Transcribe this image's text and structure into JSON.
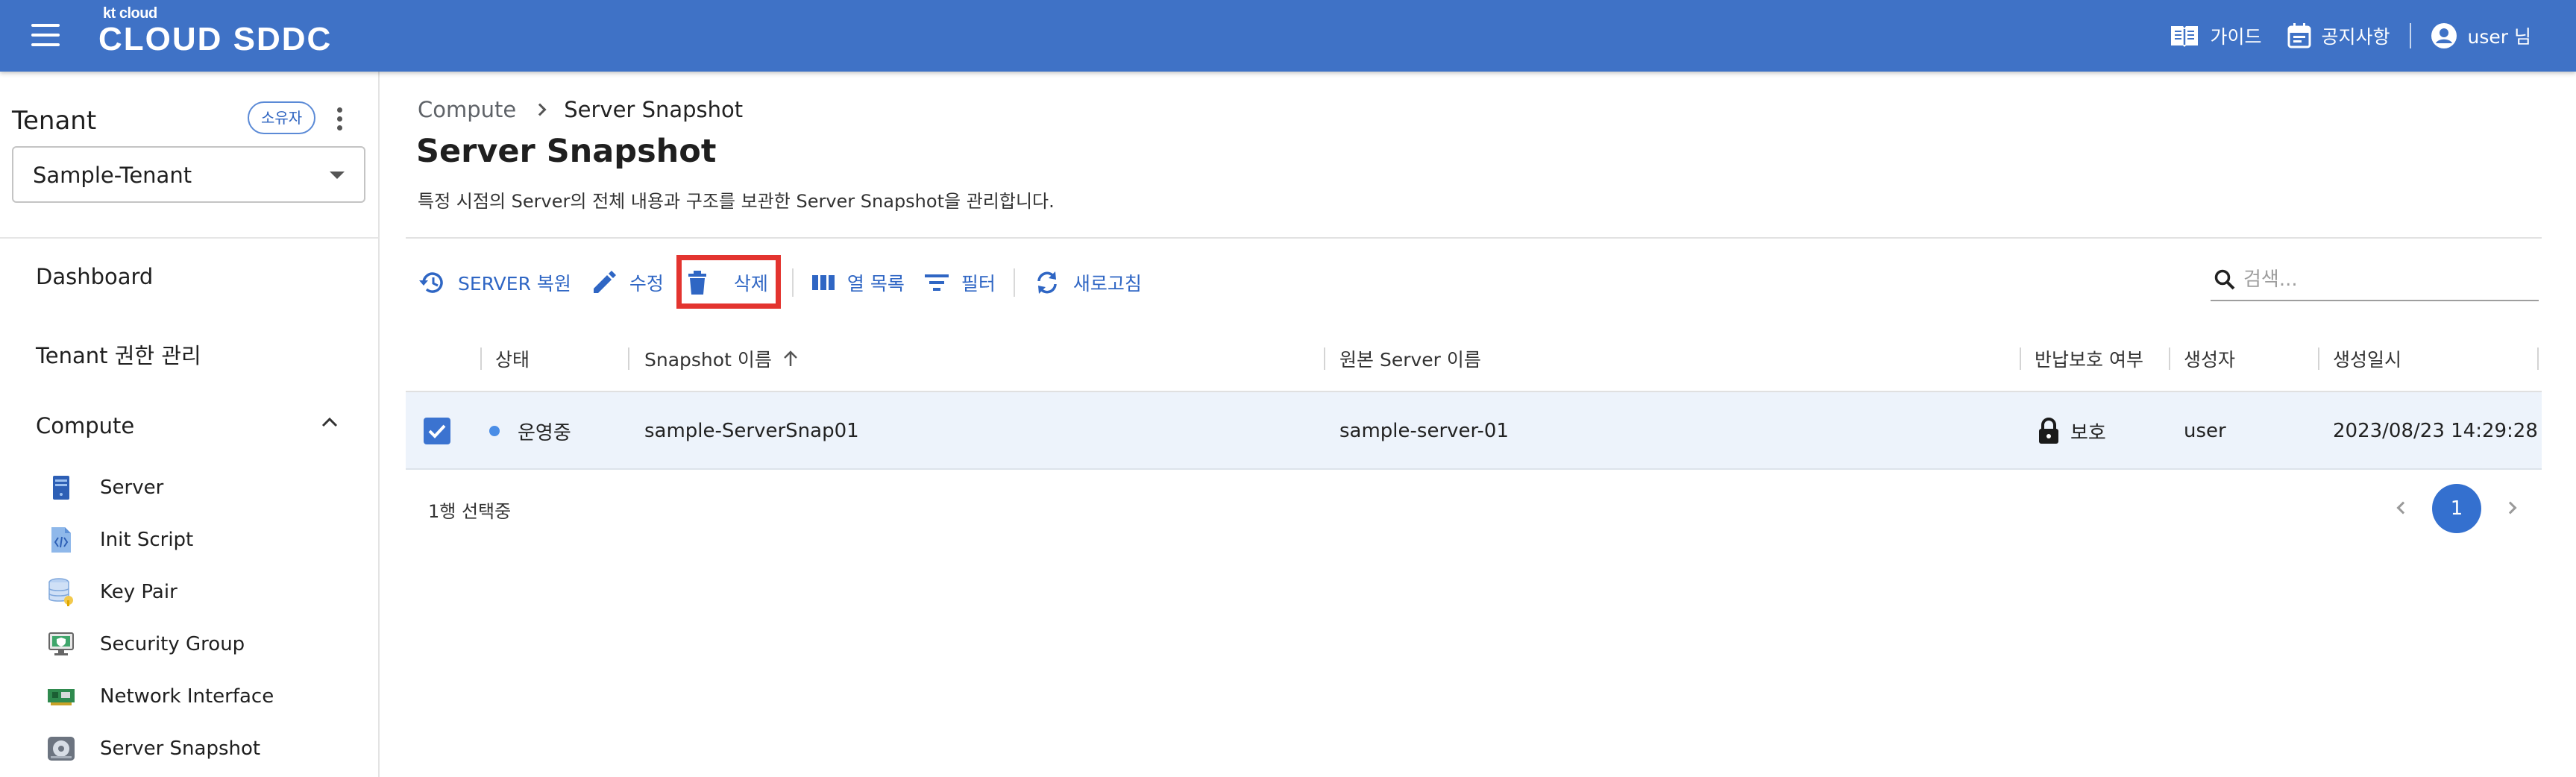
{
  "header": {
    "logo_small": "kt cloud",
    "logo_main": "CLOUD SDDC",
    "guide_label": "가이드",
    "notice_label": "공지사항",
    "user_label": "user 님",
    "bg_color": "#3f72c6"
  },
  "sidebar": {
    "tenant_title": "Tenant",
    "owner_badge": "소유자",
    "tenant_selected": "Sample-Tenant",
    "nav": {
      "dashboard": "Dashboard",
      "tenant_permission": "Tenant 권한 관리",
      "compute": "Compute"
    },
    "compute_items": [
      {
        "label": "Server",
        "icon": "server-icon"
      },
      {
        "label": "Init Script",
        "icon": "script-icon"
      },
      {
        "label": "Key Pair",
        "icon": "key-pair-icon"
      },
      {
        "label": "Security Group",
        "icon": "security-group-icon"
      },
      {
        "label": "Network Interface",
        "icon": "network-interface-icon"
      },
      {
        "label": "Server Snapshot",
        "icon": "snapshot-icon"
      }
    ]
  },
  "breadcrumb": {
    "root": "Compute",
    "current": "Server Snapshot"
  },
  "page": {
    "title": "Server Snapshot",
    "description": "특정 시점의 Server의 전체 내용과 구조를 보관한 Server Snapshot을 관리합니다."
  },
  "toolbar": {
    "restore_label": "SERVER 복원",
    "edit_label": "수정",
    "delete_label": "삭제",
    "columns_label": "열 목록",
    "filter_label": "필터",
    "refresh_label": "새로고침",
    "accent_color": "#2f66c4",
    "highlight_color": "#e3342f"
  },
  "search": {
    "placeholder": "검색..."
  },
  "table": {
    "headers": {
      "status": "상태",
      "snapshot_name": "Snapshot 이름",
      "source_server": "원본 Server 이름",
      "return_protect": "반납보호 여부",
      "creator": "생성자",
      "created_at": "생성일시"
    },
    "rows": [
      {
        "selected": true,
        "status": "운영중",
        "snapshot_name": "sample-ServerSnap01",
        "source_server": "sample-server-01",
        "return_protect": "보호",
        "creator": "user",
        "created_at": "2023/08/23 14:29:28"
      }
    ]
  },
  "footer": {
    "selection_text": "1행 선택중",
    "current_page": "1"
  }
}
